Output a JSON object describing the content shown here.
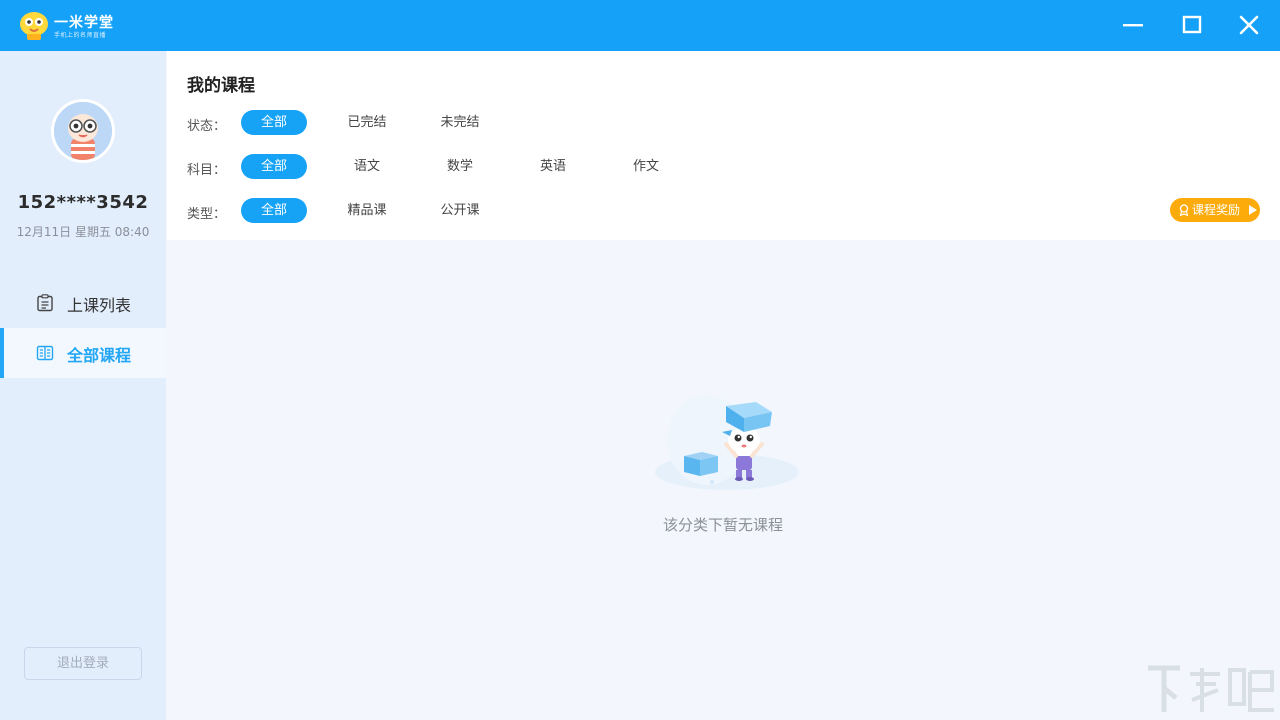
{
  "app": {
    "name": "一米学堂",
    "slogan": "手机上的名师直播"
  },
  "window_controls": {
    "minimize_icon": "minimize-icon",
    "maximize_icon": "maximize-icon",
    "close_icon": "close-icon"
  },
  "user": {
    "phone": "152****3542",
    "date": "12月11日 星期五 08:40"
  },
  "sidebar": {
    "items": [
      {
        "label": "上课列表",
        "icon": "schedule-list-icon",
        "active": false
      },
      {
        "label": "全部课程",
        "icon": "course-book-icon",
        "active": true
      }
    ],
    "logout_label": "退出登录"
  },
  "main": {
    "title": "我的课程",
    "filters": {
      "status": {
        "label": "状态：",
        "options": [
          "全部",
          "已完结",
          "未完结"
        ],
        "selected": "全部"
      },
      "subject": {
        "label": "科目：",
        "options": [
          "全部",
          "语文",
          "数学",
          "英语",
          "作文"
        ],
        "selected": "全部"
      },
      "type": {
        "label": "类型：",
        "options": [
          "全部",
          "精品课",
          "公开课"
        ],
        "selected": "全部"
      }
    },
    "reward_label": "课程奖励",
    "empty_text": "该分类下暂无课程"
  },
  "colors": {
    "accent": "#16a3f6",
    "titlebar": "#15a1f8",
    "reward": "#fcab0a",
    "sidebar_bg": "#e3eefd"
  }
}
